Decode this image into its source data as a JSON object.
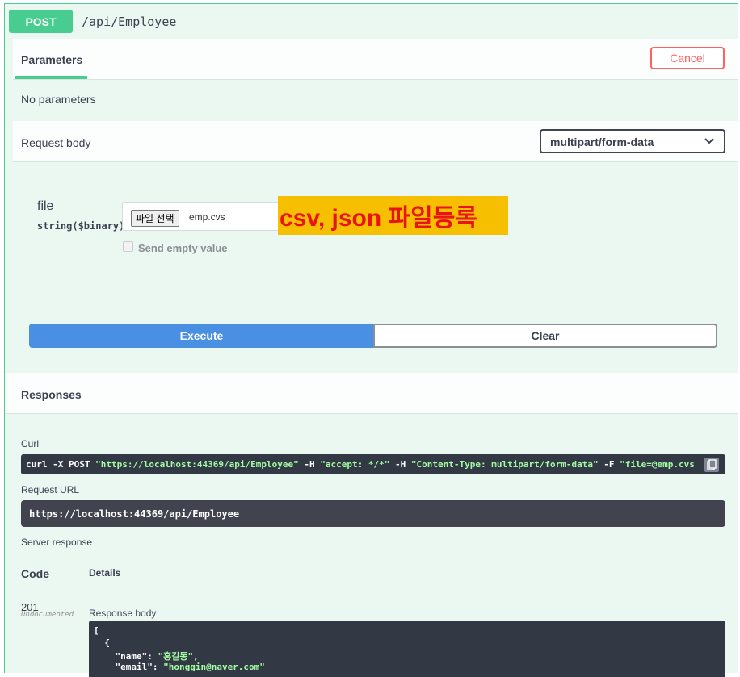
{
  "operation": {
    "method": "POST",
    "path": "/api/Employee"
  },
  "parameters": {
    "tab_label": "Parameters",
    "cancel_label": "Cancel",
    "empty_text": "No parameters"
  },
  "request_body": {
    "label": "Request body",
    "content_type": "multipart/form-data",
    "field_name": "file",
    "field_type": "string($binary)",
    "choose_button": "파일 선택",
    "file_name": "emp.cvs",
    "send_empty_label": "Send empty value",
    "annotation": "csv, json 파일등록"
  },
  "actions": {
    "execute_label": "Execute",
    "clear_label": "Clear"
  },
  "responses": {
    "title": "Responses",
    "curl_label": "Curl",
    "curl_cmd": "curl -X POST ",
    "curl_url": "\"https://localhost:44369/api/Employee\"",
    "curl_h": " -H  ",
    "curl_accept": "\"accept: */*\"",
    "curl_h2": " -H  ",
    "curl_ct": "\"Content-Type: multipart/form-data\"",
    "curl_f": " -F ",
    "curl_file": "\"file=@emp.cvs",
    "request_url_label": "Request URL",
    "request_url": "https://localhost:44369/api/Employee",
    "server_response_label": "Server response",
    "code_header": "Code",
    "details_header": "Details",
    "code": "201",
    "undocumented": "Undocumented",
    "response_body_label": "Response body",
    "body_line1": "[",
    "body_line2": "  {",
    "body_key_name": "    \"name\": ",
    "body_val_name": "\"홍길동\"",
    "body_comma": ",",
    "body_key_email": "    \"email\": ",
    "body_val_email": "\"honggin@naver.com\""
  }
}
